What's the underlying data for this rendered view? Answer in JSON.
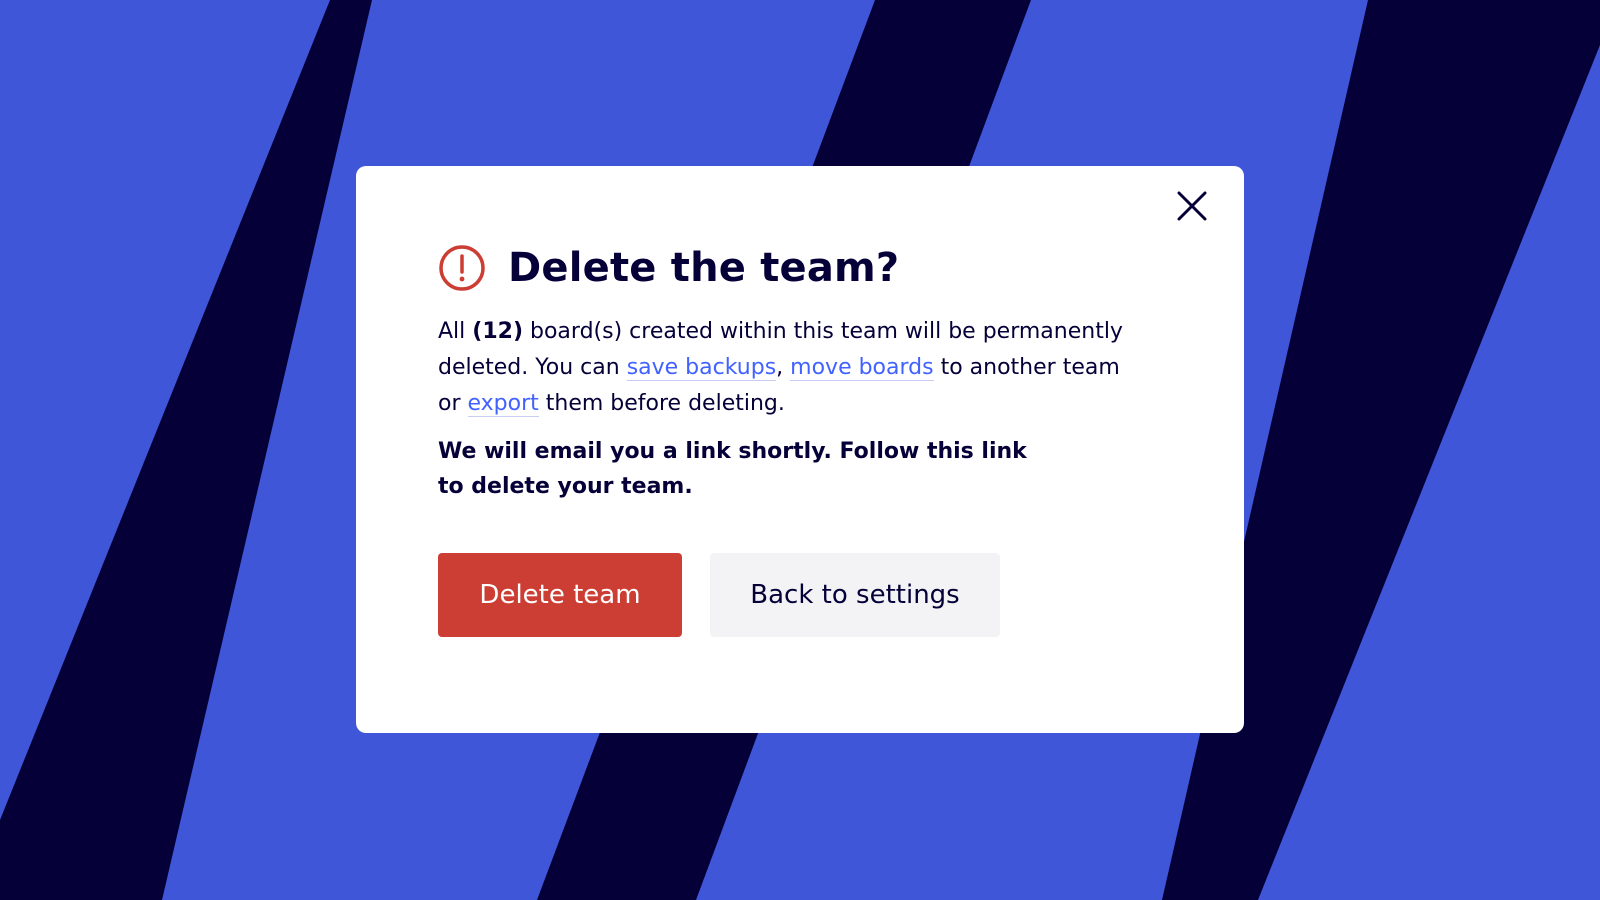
{
  "dialog": {
    "title": "Delete the team?",
    "close_label": "Close",
    "body": {
      "part1": "All ",
      "count": "(12)",
      "part2": " board(s) created within this team will be permanently deleted. You can ",
      "link_backups": "save backups",
      "comma": ",",
      "space": " ",
      "link_move": "move boards",
      "part3": " to another team or ",
      "link_export": "export",
      "part4": " them before deleting."
    },
    "notice": "We will email you a link shortly. Follow this link to delete your team.",
    "primary_button": "Delete team",
    "secondary_button": "Back to settings"
  },
  "colors": {
    "background": "#3f56d9",
    "stripe": "#050038",
    "danger": "#cc3d33",
    "link": "#4262ff",
    "text": "#050038"
  },
  "icons": {
    "warning": "warning-circle-icon",
    "close": "close-icon"
  }
}
